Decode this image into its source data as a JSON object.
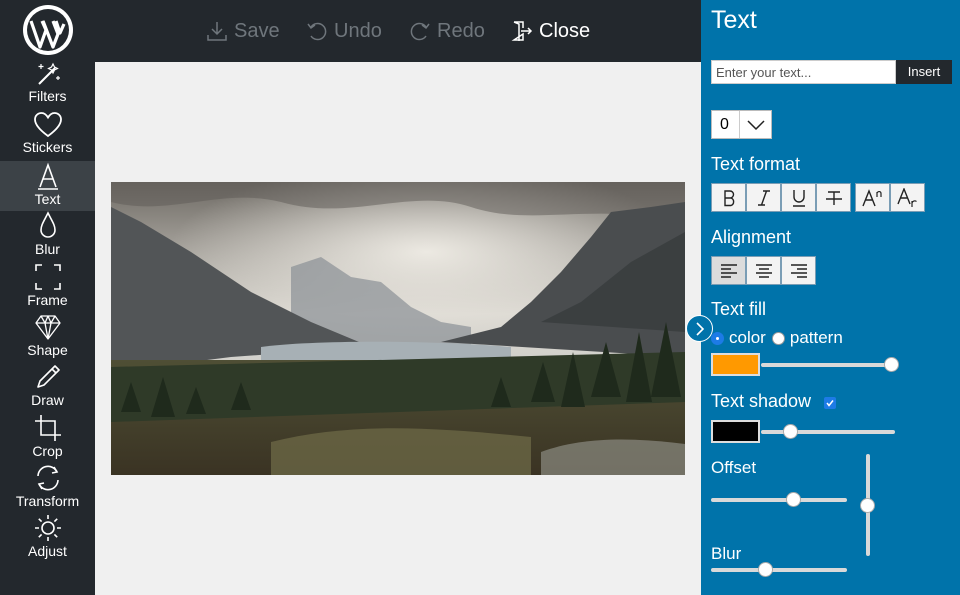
{
  "toolbar": {
    "save_label": "Save",
    "undo_label": "Undo",
    "redo_label": "Redo",
    "close_label": "Close"
  },
  "sidebar": {
    "logo": "wordpress-logo",
    "items": [
      {
        "label": "Filters",
        "icon": "magic-wand-icon"
      },
      {
        "label": "Stickers",
        "icon": "heart-icon"
      },
      {
        "label": "Text",
        "icon": "text-a-icon",
        "active": true
      },
      {
        "label": "Blur",
        "icon": "droplet-icon"
      },
      {
        "label": "Frame",
        "icon": "frame-icon"
      },
      {
        "label": "Shape",
        "icon": "diamond-icon"
      },
      {
        "label": "Draw",
        "icon": "pencil-icon"
      },
      {
        "label": "Crop",
        "icon": "crop-icon"
      },
      {
        "label": "Transform",
        "icon": "rotate-icon"
      },
      {
        "label": "Adjust",
        "icon": "sun-icon"
      }
    ]
  },
  "panel": {
    "title": "Text",
    "input_placeholder": "Enter your text...",
    "insert_label": "Insert",
    "font_size_value": "0",
    "text_format_label": "Text format",
    "format_buttons": [
      "bold",
      "italic",
      "underline",
      "strikethrough",
      "superscript",
      "subscript"
    ],
    "alignment_label": "Alignment",
    "alignment_options": [
      "left",
      "center",
      "right"
    ],
    "alignment_selected": "left",
    "text_fill_label": "Text fill",
    "fill_color_option": "color",
    "fill_pattern_option": "pattern",
    "fill_selected": "color",
    "fill_color": "#ff9900",
    "fill_slider_level": 1.0,
    "text_shadow_label": "Text shadow",
    "text_shadow_enabled": true,
    "shadow_color": "#000000",
    "shadow_slider_level": 0.22,
    "offset_label": "Offset",
    "offset_x_level": 0.6,
    "offset_y_level": 0.5,
    "blur_label": "Blur",
    "blur_level": 0.4
  },
  "colors": {
    "sidebar_bg": "#23282d",
    "panel_bg": "#0073aa",
    "canvas_bg": "#f0f0f0",
    "active_tool_bg": "#3c4247"
  }
}
